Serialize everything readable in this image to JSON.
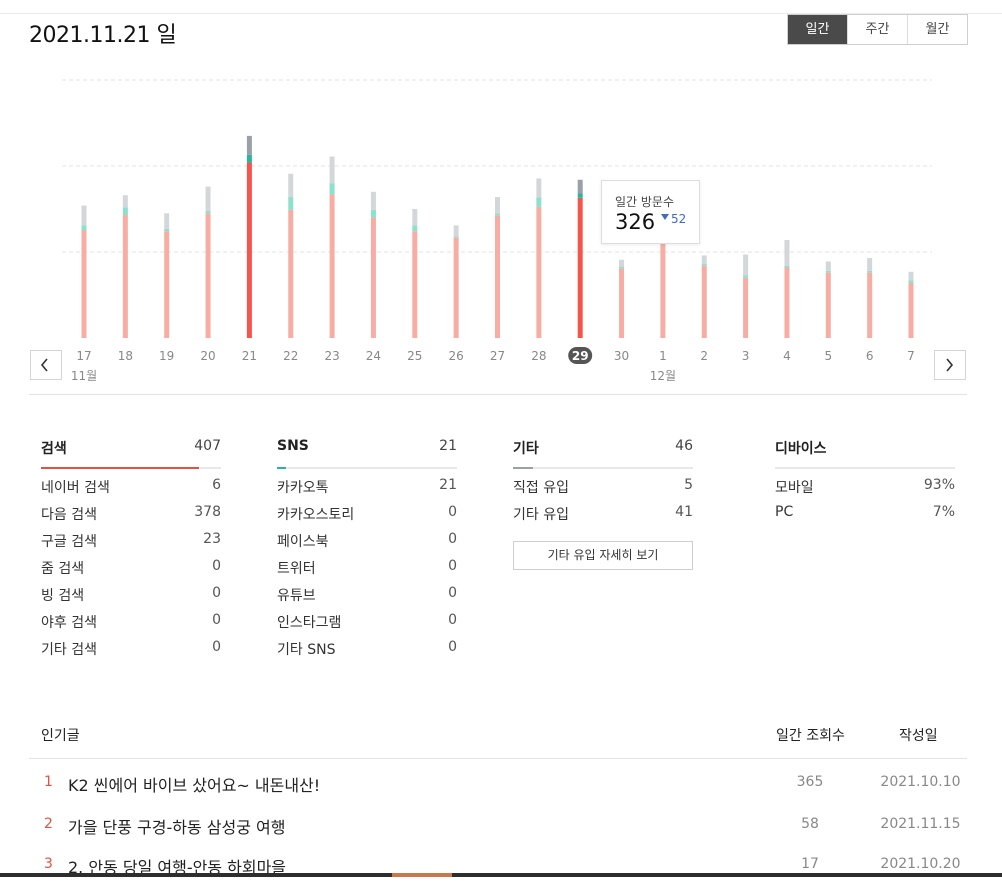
{
  "header": {
    "date_title": "2021.11.21 일",
    "tabs": [
      {
        "label": "일간",
        "active": true
      },
      {
        "label": "주간",
        "active": false
      },
      {
        "label": "월간",
        "active": false
      }
    ]
  },
  "chart_data": {
    "type": "bar",
    "categories": [
      "17",
      "18",
      "19",
      "20",
      "21",
      "22",
      "23",
      "24",
      "25",
      "26",
      "27",
      "28",
      "29",
      "30",
      "1",
      "2",
      "3",
      "4",
      "5",
      "6",
      "7"
    ],
    "month_labels": [
      {
        "label": "11월",
        "at_index": 0
      },
      {
        "label": "12월",
        "at_index": 14
      }
    ],
    "selected_indices": [
      4,
      12
    ],
    "highlighted_label_index": 12,
    "series": [
      {
        "values": [
          250,
          286,
          248,
          290,
          408,
          298,
          334,
          280,
          248,
          234,
          284,
          305,
          326,
          162,
          236,
          168,
          140,
          164,
          152,
          152,
          128
        ]
      },
      {
        "values": [
          12,
          18,
          6,
          6,
          18,
          30,
          26,
          18,
          14,
          2,
          6,
          22,
          10,
          4,
          4,
          4,
          6,
          4,
          4,
          4,
          6
        ]
      },
      {
        "values": [
          46,
          28,
          36,
          56,
          44,
          54,
          62,
          42,
          38,
          26,
          38,
          44,
          32,
          16,
          20,
          20,
          48,
          60,
          22,
          30,
          20
        ]
      }
    ],
    "colors": {
      "base": "#f7ada3",
      "base_selected": "#f5554a",
      "mid": "#8de0cd",
      "mid_selected": "#2bb5a0",
      "top": "#d4d7da",
      "top_selected": "#9aa0a7",
      "label_highlight_bg": "#555555"
    },
    "ylim": [
      0,
      600
    ],
    "gridlines": [
      200,
      400,
      600
    ]
  },
  "tooltip": {
    "label": "일간 방문수",
    "value": "326",
    "delta": "52",
    "delta_icon": "triangle-down-icon"
  },
  "stats": {
    "search": {
      "title": "검색",
      "total": "407",
      "accent": "#e8503f",
      "fill_fraction": 0.88,
      "rows": [
        {
          "label": "네이버 검색",
          "value": "6"
        },
        {
          "label": "다음 검색",
          "value": "378"
        },
        {
          "label": "구글 검색",
          "value": "23"
        },
        {
          "label": "줌 검색",
          "value": "0"
        },
        {
          "label": "빙 검색",
          "value": "0"
        },
        {
          "label": "야후 검색",
          "value": "0"
        },
        {
          "label": "기타 검색",
          "value": "0"
        }
      ]
    },
    "sns": {
      "title": "SNS",
      "total": "21",
      "accent": "#2bb5a0",
      "fill_fraction": 0.05,
      "rows": [
        {
          "label": "카카오톡",
          "value": "21"
        },
        {
          "label": "카카오스토리",
          "value": "0"
        },
        {
          "label": "페이스북",
          "value": "0"
        },
        {
          "label": "트위터",
          "value": "0"
        },
        {
          "label": "유튜브",
          "value": "0"
        },
        {
          "label": "인스타그램",
          "value": "0"
        },
        {
          "label": "기타 SNS",
          "value": "0"
        }
      ]
    },
    "etc": {
      "title": "기타",
      "total": "46",
      "accent": "#9aa0a7",
      "fill_fraction": 0.11,
      "rows": [
        {
          "label": "직접 유입",
          "value": "5"
        },
        {
          "label": "기타 유입",
          "value": "41"
        }
      ],
      "detail_button": "기타 유입 자세히 보기"
    },
    "device": {
      "title": "디바이스",
      "rows": [
        {
          "label": "모바일",
          "value": "93%"
        },
        {
          "label": "PC",
          "value": "7%"
        }
      ]
    }
  },
  "popular": {
    "title": "인기글",
    "views_header": "일간 조회수",
    "date_header": "작성일",
    "rows": [
      {
        "rank": "1",
        "title": "K2 씬에어 바이브 샀어요~ 내돈내산!",
        "views": "365",
        "date": "2021.10.10"
      },
      {
        "rank": "2",
        "title": "가을 단풍 구경-하동 삼성궁 여행",
        "views": "58",
        "date": "2021.11.15"
      },
      {
        "rank": "3",
        "title": "2. 안동 당일 여행-안동 하회마을",
        "views": "17",
        "date": "2021.10.20"
      }
    ]
  }
}
